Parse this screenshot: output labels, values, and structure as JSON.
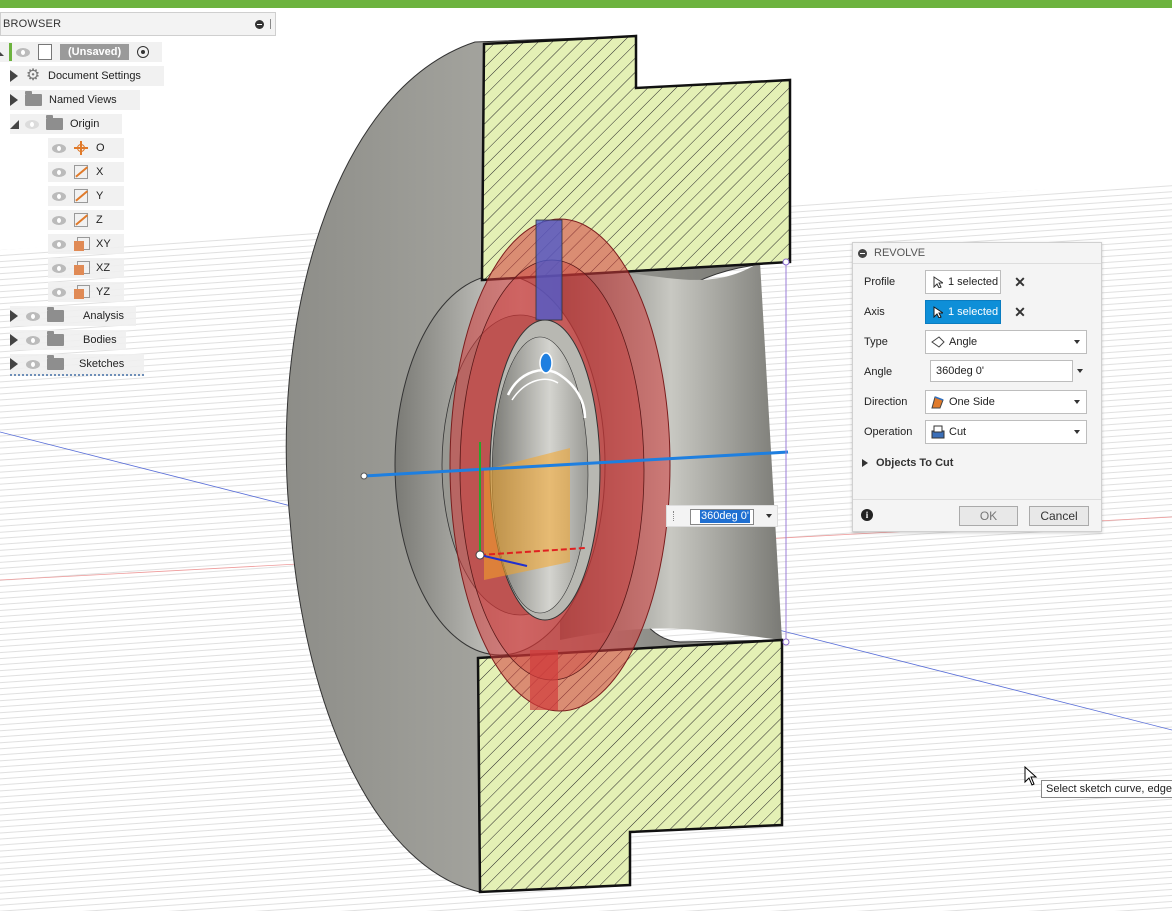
{
  "browser": {
    "title": "BROWSER",
    "root": "(Unsaved)",
    "items": {
      "document_settings": "Document Settings",
      "named_views": "Named Views",
      "origin": "Origin",
      "o": "O",
      "x": "X",
      "y": "Y",
      "z": "Z",
      "xy": "XY",
      "xz": "XZ",
      "yz": "YZ",
      "analysis": "Analysis",
      "bodies": "Bodies",
      "sketches": "Sketches"
    }
  },
  "revolve": {
    "title": "REVOLVE",
    "profile_label": "Profile",
    "profile_value": "1 selected",
    "axis_label": "Axis",
    "axis_value": "1 selected",
    "type_label": "Type",
    "type_value": "Angle",
    "angle_label": "Angle",
    "angle_value": "360deg 0'",
    "direction_label": "Direction",
    "direction_value": "One Side",
    "operation_label": "Operation",
    "operation_value": "Cut",
    "objects_to_cut": "Objects To Cut",
    "ok": "OK",
    "cancel": "Cancel"
  },
  "canvas": {
    "angle_input": "360deg 0'",
    "tooltip": "Select sketch curve, edge,"
  },
  "colors": {
    "top_bar": "#6db33f",
    "section_fill": "#e4f0b5",
    "selection_red": "#cc3b3b",
    "axis_blue": "#1e7fe0",
    "dialog_active": "#0e8fd8"
  }
}
